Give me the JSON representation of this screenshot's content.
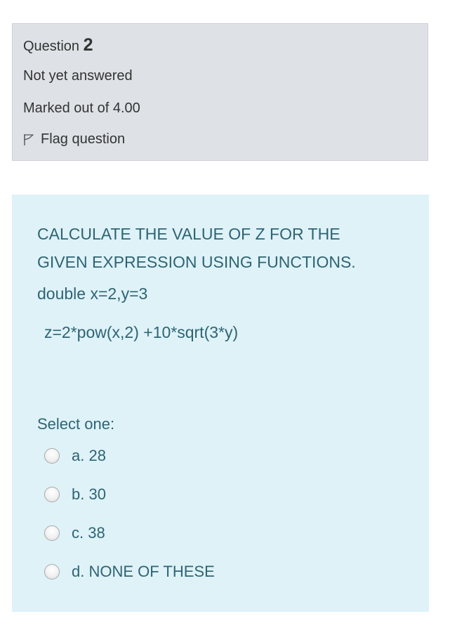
{
  "info": {
    "question_word": "Question",
    "question_number": "2",
    "state": "Not yet answered",
    "grade": "Marked out of 4.00",
    "flag_label": "Flag question",
    "flag_icon": "flag-icon"
  },
  "question": {
    "text_line1": "CALCULATE THE VALUE OF Z FOR THE",
    "text_line2": "GIVEN EXPRESSION USING FUNCTIONS.",
    "code_line1": "double x=2,y=3",
    "code_line2": "z=2*pow(x,2) +10*sqrt(3*y)",
    "prompt": "Select one:",
    "options": [
      {
        "label": "a. 28"
      },
      {
        "label": "b. 30"
      },
      {
        "label": "c. 38"
      },
      {
        "label": "d. NONE OF THESE"
      }
    ]
  },
  "colors": {
    "info_background": "#dee2e6",
    "content_background": "#def2f8",
    "content_text": "#2f6473",
    "info_text": "#333333"
  }
}
